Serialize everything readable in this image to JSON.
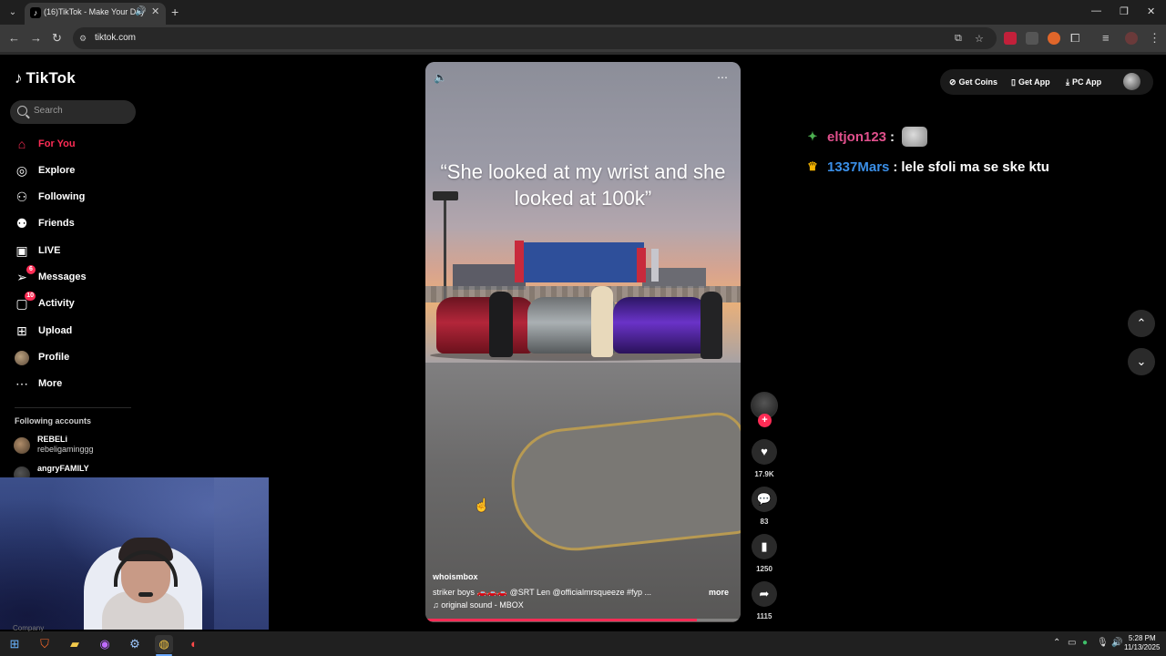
{
  "browser": {
    "tab_title": "(16)TikTok - Make Your Day",
    "url": "tiktok.com"
  },
  "tiktok": {
    "logo_text": "TikTok",
    "search": {
      "placeholder": "Search"
    },
    "nav": [
      {
        "label": "For You",
        "icon": "home-icon",
        "active": true
      },
      {
        "label": "Explore",
        "icon": "compass-icon"
      },
      {
        "label": "Following",
        "icon": "following-icon"
      },
      {
        "label": "Friends",
        "icon": "friends-icon"
      },
      {
        "label": "LIVE",
        "icon": "live-icon"
      },
      {
        "label": "Messages",
        "icon": "messages-icon",
        "badge": "6"
      },
      {
        "label": "Activity",
        "icon": "activity-icon",
        "badge": "10"
      },
      {
        "label": "Upload",
        "icon": "upload-icon"
      },
      {
        "label": "Profile",
        "icon": "profile-icon"
      },
      {
        "label": "More",
        "icon": "more-icon"
      }
    ],
    "following_accounts": {
      "title": "Following accounts",
      "accounts": [
        {
          "name": "REBELi",
          "handle": "rebeligaminggg"
        },
        {
          "name": "angryFAMILY",
          "handle": ""
        }
      ]
    },
    "top_actions": {
      "coins": "Get Coins",
      "app": "Get App",
      "pc_app": "PC App"
    },
    "video": {
      "caption": "“She looked at my wrist and she looked at 100k”",
      "author": "whoismbox",
      "description": "striker boys 🚗🚗🚗 @SRT Len  @officialmrsqueeze  #fyp  ...",
      "more": "more",
      "sound": "♫ original sound - MBOX",
      "progress_fraction": 0.86
    },
    "actions": {
      "likes": "17.9K",
      "comments": "83",
      "saves": "1250",
      "shares": "1115"
    }
  },
  "chat_overlay": [
    {
      "user": "eltjon123",
      "sep": ":",
      "message": "",
      "user_color": "#e0508c",
      "badge_color": "#4caf50",
      "emote": true
    },
    {
      "user": "1337Mars",
      "sep": ":",
      "message": "lele sfoli ma se ske ktu",
      "user_color": "#3a8ee6",
      "badge_color": "#f5b400",
      "emote": false
    }
  ],
  "webcam": {
    "caption": "Company"
  },
  "taskbar": {
    "time": "5:28 PM",
    "date": "11/13/2025"
  }
}
